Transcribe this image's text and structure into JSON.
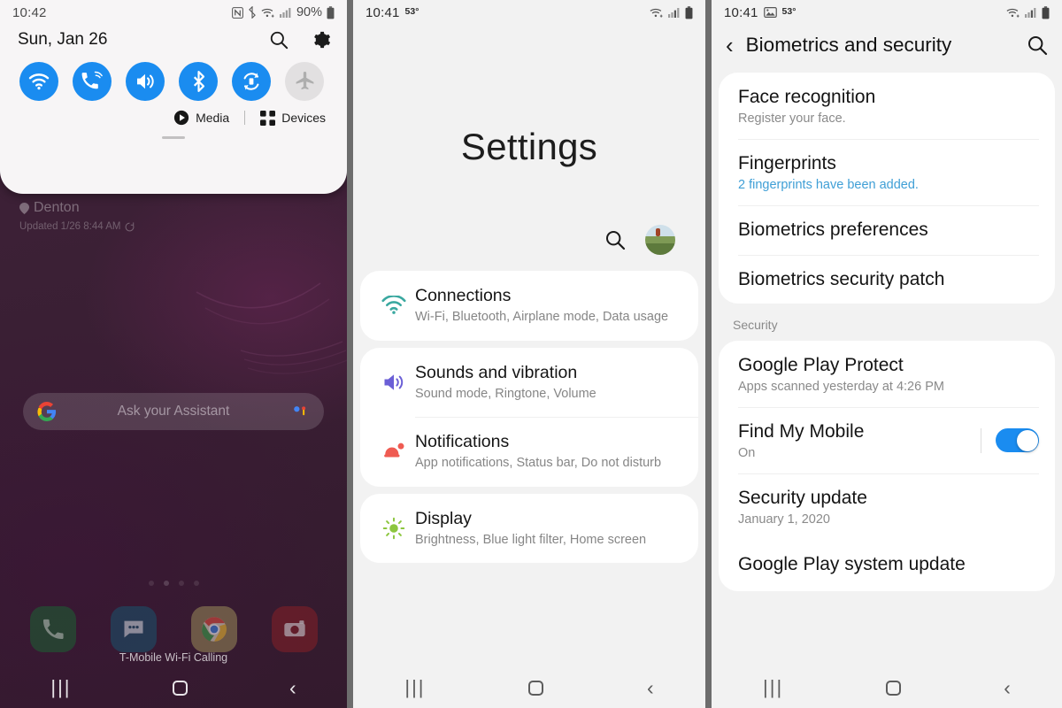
{
  "home_panel": {
    "status_bar": {
      "time": "10:42",
      "battery_percent": "90%",
      "icons": [
        "nfc-icon",
        "bluetooth-icon",
        "wifi-icon",
        "signal-icon",
        "battery-icon"
      ]
    },
    "quick_settings": {
      "date": "Sun, Jan 26",
      "search_icon": "search-icon",
      "settings_icon": "gear-icon",
      "toggles": [
        {
          "name": "wifi",
          "label": "Wi-Fi",
          "state": "on"
        },
        {
          "name": "wifi-calling",
          "label": "Wi-Fi Calling",
          "state": "on"
        },
        {
          "name": "sound",
          "label": "Sound",
          "state": "on"
        },
        {
          "name": "bluetooth",
          "label": "Bluetooth",
          "state": "on"
        },
        {
          "name": "auto-rotate",
          "label": "Auto rotate",
          "state": "on"
        },
        {
          "name": "airplane-mode",
          "label": "Airplane mode",
          "state": "off"
        }
      ],
      "media_label": "Media",
      "devices_label": "Devices",
      "accent_color": "#1a8cf0",
      "inactive_color": "#e2e0e1"
    },
    "weather_widget": {
      "city": "Denton",
      "updated": "Updated 1/26 8:44 AM"
    },
    "assistant_bar": {
      "placeholder": "Ask your Assistant"
    },
    "dock": {
      "apps": [
        "phone",
        "messages",
        "chrome",
        "camera"
      ],
      "wifi_calling_label": "T-Mobile Wi-Fi Calling"
    },
    "nav_bar": {
      "recents": "|||",
      "home": "home-icon",
      "back": "‹"
    },
    "wallpaper_color": "#3a1f34"
  },
  "settings_panel": {
    "status_bar": {
      "time": "10:41",
      "temperature": "53°",
      "icons": [
        "wifi-icon",
        "signal-icon",
        "battery-icon"
      ]
    },
    "title": "Settings",
    "search_icon": "search-icon",
    "avatar": "user-avatar",
    "items": [
      {
        "icon": "wifi-icon",
        "icon_color": "#3aa8a0",
        "title": "Connections",
        "subtitle": "Wi-Fi, Bluetooth, Airplane mode, Data usage"
      },
      {
        "icon": "volume-icon",
        "icon_color": "#6b5fd6",
        "title": "Sounds and vibration",
        "subtitle": "Sound mode, Ringtone, Volume"
      },
      {
        "icon": "notification-icon",
        "icon_color": "#ef5b52",
        "title": "Notifications",
        "subtitle": "App notifications, Status bar, Do not disturb"
      },
      {
        "icon": "brightness-icon",
        "icon_color": "#8cc63e",
        "title": "Display",
        "subtitle": "Brightness, Blue light filter, Home screen"
      }
    ],
    "nav_bar": {
      "recents": "|||",
      "home": "home-icon",
      "back": "‹"
    }
  },
  "biometrics_panel": {
    "status_bar": {
      "time": "10:41",
      "temperature": "53°",
      "icons": [
        "image-icon",
        "wifi-icon",
        "signal-icon",
        "battery-icon"
      ]
    },
    "header": {
      "back_icon": "back-arrow-icon",
      "title": "Biometrics and security",
      "search_icon": "search-icon"
    },
    "biometrics_items": [
      {
        "title": "Face recognition",
        "subtitle": "Register your face.",
        "subtitle_style": "muted"
      },
      {
        "title": "Fingerprints",
        "subtitle": "2 fingerprints have been added.",
        "subtitle_style": "link"
      },
      {
        "title": "Biometrics preferences",
        "subtitle": "",
        "subtitle_style": "none"
      },
      {
        "title": "Biometrics security patch",
        "subtitle": "",
        "subtitle_style": "none"
      }
    ],
    "security_section_label": "Security",
    "security_items": [
      {
        "title": "Google Play Protect",
        "subtitle": "Apps scanned yesterday at 4:26 PM",
        "toggle": null
      },
      {
        "title": "Find My Mobile",
        "subtitle": "On",
        "toggle": "on"
      },
      {
        "title": "Security update",
        "subtitle": "January 1, 2020",
        "toggle": null
      },
      {
        "title": "Google Play system update",
        "subtitle": "",
        "toggle": null
      }
    ],
    "link_color": "#3f9fd6",
    "toggle_on_color": "#1a8cf0",
    "nav_bar": {
      "recents": "|||",
      "home": "home-icon",
      "back": "‹"
    }
  }
}
